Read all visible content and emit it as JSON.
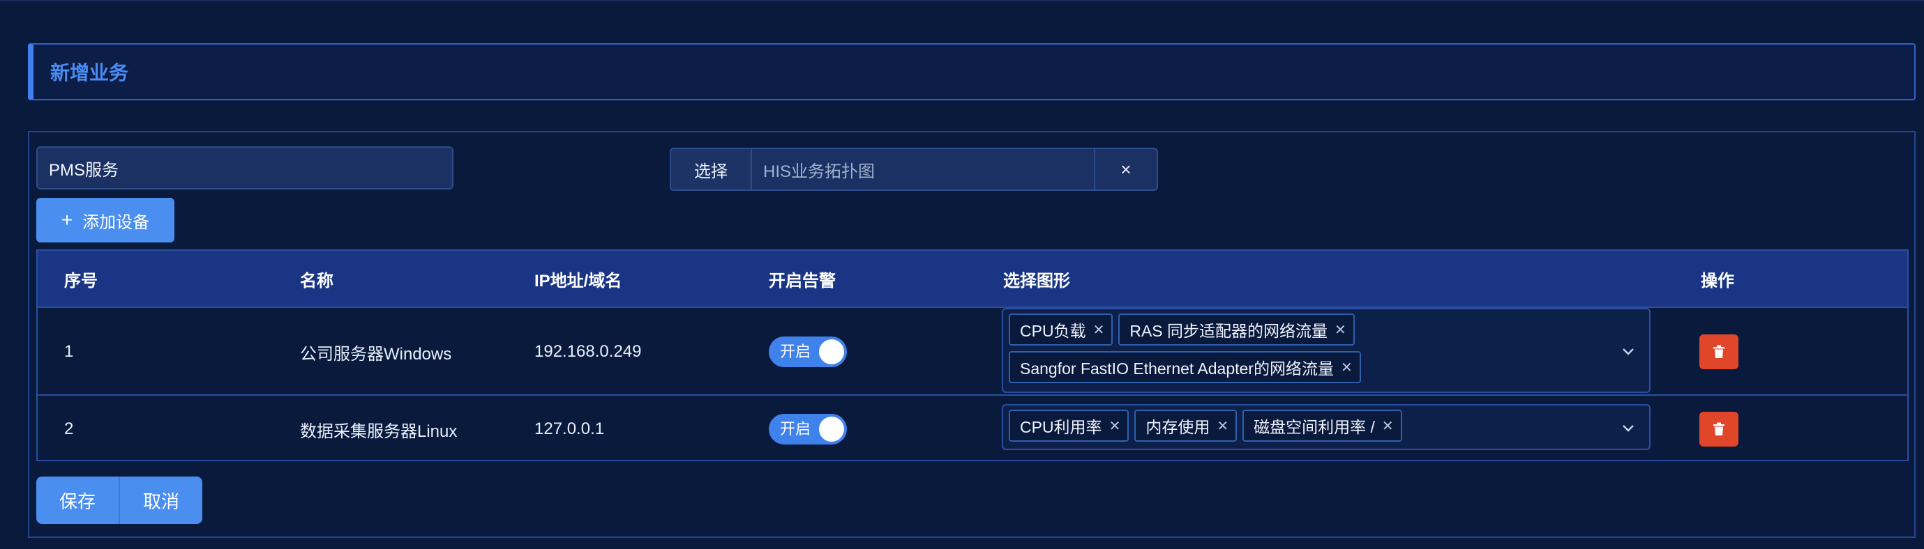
{
  "header": {
    "title": "新增业务"
  },
  "form": {
    "name_value": "PMS服务",
    "topology": {
      "select_label": "选择",
      "value": "HIS业务拓扑图",
      "clear_label": "×"
    },
    "add_device_label": "添加设备"
  },
  "table": {
    "columns": [
      "序号",
      "名称",
      "IP地址/域名",
      "开启告警",
      "选择图形",
      "操作"
    ],
    "rows": [
      {
        "index": "1",
        "name": "公司服务器Windows",
        "ip": "192.168.0.249",
        "alarm_on": true,
        "alarm_label": "开启",
        "graphs": [
          "CPU负载",
          "RAS 同步适配器的网络流量",
          "Sangfor FastIO Ethernet Adapter的网络流量"
        ]
      },
      {
        "index": "2",
        "name": "数据采集服务器Linux",
        "ip": "127.0.0.1",
        "alarm_on": true,
        "alarm_label": "开启",
        "graphs": [
          "CPU利用率",
          "内存使用",
          "磁盘空间利用率 /"
        ]
      }
    ]
  },
  "footer": {
    "save_label": "保存",
    "cancel_label": "取消"
  },
  "colors": {
    "accent": "#4a8eef",
    "danger": "#e0472a",
    "background": "#0a1a3c",
    "header_row": "#1a3584"
  }
}
